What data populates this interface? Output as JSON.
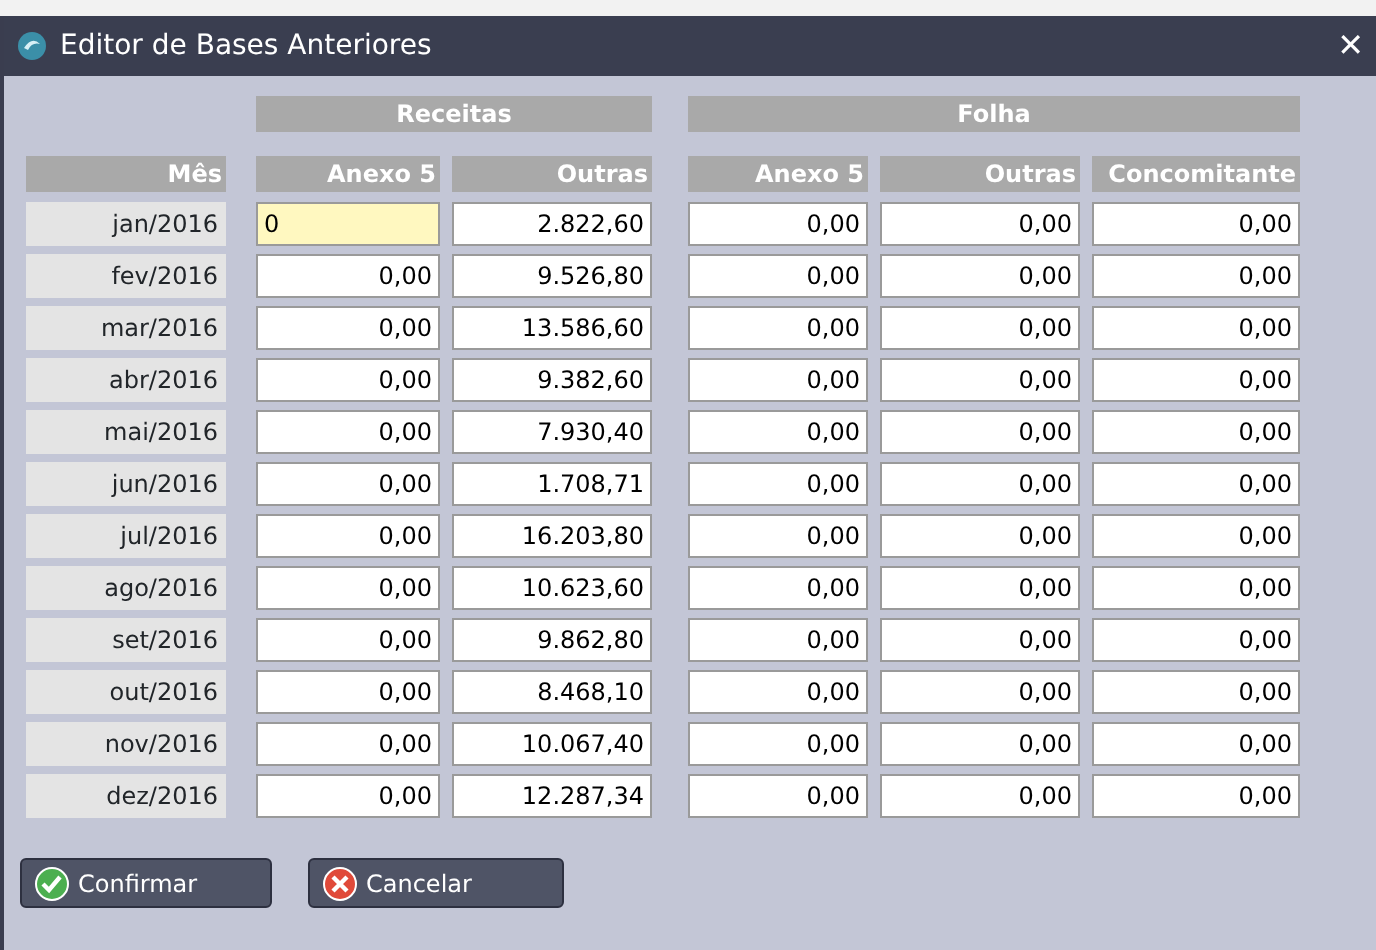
{
  "window": {
    "title": "Editor de Bases Anteriores",
    "close": "✕"
  },
  "groups": [
    {
      "label": "Receitas"
    },
    {
      "label": "Folha"
    }
  ],
  "columns": [
    "Mês",
    "Anexo 5",
    "Outras",
    "Anexo 5",
    "Outras",
    "Concomitante"
  ],
  "rows": [
    {
      "month": "jan/2016",
      "cells": [
        {
          "value": "0",
          "focused": true
        },
        {
          "value": "2.822,60",
          "focused": false
        },
        {
          "value": "0,00",
          "focused": false
        },
        {
          "value": "0,00",
          "focused": false
        },
        {
          "value": "0,00",
          "focused": false
        }
      ]
    },
    {
      "month": "fev/2016",
      "cells": [
        {
          "value": "0,00",
          "focused": false
        },
        {
          "value": "9.526,80",
          "focused": false
        },
        {
          "value": "0,00",
          "focused": false
        },
        {
          "value": "0,00",
          "focused": false
        },
        {
          "value": "0,00",
          "focused": false
        }
      ]
    },
    {
      "month": "mar/2016",
      "cells": [
        {
          "value": "0,00",
          "focused": false
        },
        {
          "value": "13.586,60",
          "focused": false
        },
        {
          "value": "0,00",
          "focused": false
        },
        {
          "value": "0,00",
          "focused": false
        },
        {
          "value": "0,00",
          "focused": false
        }
      ]
    },
    {
      "month": "abr/2016",
      "cells": [
        {
          "value": "0,00",
          "focused": false
        },
        {
          "value": "9.382,60",
          "focused": false
        },
        {
          "value": "0,00",
          "focused": false
        },
        {
          "value": "0,00",
          "focused": false
        },
        {
          "value": "0,00",
          "focused": false
        }
      ]
    },
    {
      "month": "mai/2016",
      "cells": [
        {
          "value": "0,00",
          "focused": false
        },
        {
          "value": "7.930,40",
          "focused": false
        },
        {
          "value": "0,00",
          "focused": false
        },
        {
          "value": "0,00",
          "focused": false
        },
        {
          "value": "0,00",
          "focused": false
        }
      ]
    },
    {
      "month": "jun/2016",
      "cells": [
        {
          "value": "0,00",
          "focused": false
        },
        {
          "value": "1.708,71",
          "focused": false
        },
        {
          "value": "0,00",
          "focused": false
        },
        {
          "value": "0,00",
          "focused": false
        },
        {
          "value": "0,00",
          "focused": false
        }
      ]
    },
    {
      "month": "jul/2016",
      "cells": [
        {
          "value": "0,00",
          "focused": false
        },
        {
          "value": "16.203,80",
          "focused": false
        },
        {
          "value": "0,00",
          "focused": false
        },
        {
          "value": "0,00",
          "focused": false
        },
        {
          "value": "0,00",
          "focused": false
        }
      ]
    },
    {
      "month": "ago/2016",
      "cells": [
        {
          "value": "0,00",
          "focused": false
        },
        {
          "value": "10.623,60",
          "focused": false
        },
        {
          "value": "0,00",
          "focused": false
        },
        {
          "value": "0,00",
          "focused": false
        },
        {
          "value": "0,00",
          "focused": false
        }
      ]
    },
    {
      "month": "set/2016",
      "cells": [
        {
          "value": "0,00",
          "focused": false
        },
        {
          "value": "9.862,80",
          "focused": false
        },
        {
          "value": "0,00",
          "focused": false
        },
        {
          "value": "0,00",
          "focused": false
        },
        {
          "value": "0,00",
          "focused": false
        }
      ]
    },
    {
      "month": "out/2016",
      "cells": [
        {
          "value": "0,00",
          "focused": false
        },
        {
          "value": "8.468,10",
          "focused": false
        },
        {
          "value": "0,00",
          "focused": false
        },
        {
          "value": "0,00",
          "focused": false
        },
        {
          "value": "0,00",
          "focused": false
        }
      ]
    },
    {
      "month": "nov/2016",
      "cells": [
        {
          "value": "0,00",
          "focused": false
        },
        {
          "value": "10.067,40",
          "focused": false
        },
        {
          "value": "0,00",
          "focused": false
        },
        {
          "value": "0,00",
          "focused": false
        },
        {
          "value": "0,00",
          "focused": false
        }
      ]
    },
    {
      "month": "dez/2016",
      "cells": [
        {
          "value": "0,00",
          "focused": false
        },
        {
          "value": "12.287,34",
          "focused": false
        },
        {
          "value": "0,00",
          "focused": false
        },
        {
          "value": "0,00",
          "focused": false
        },
        {
          "value": "0,00",
          "focused": false
        }
      ]
    }
  ],
  "buttons": [
    {
      "label": "Confirmar",
      "kind": "confirm"
    },
    {
      "label": "Cancelar",
      "kind": "cancel"
    }
  ]
}
